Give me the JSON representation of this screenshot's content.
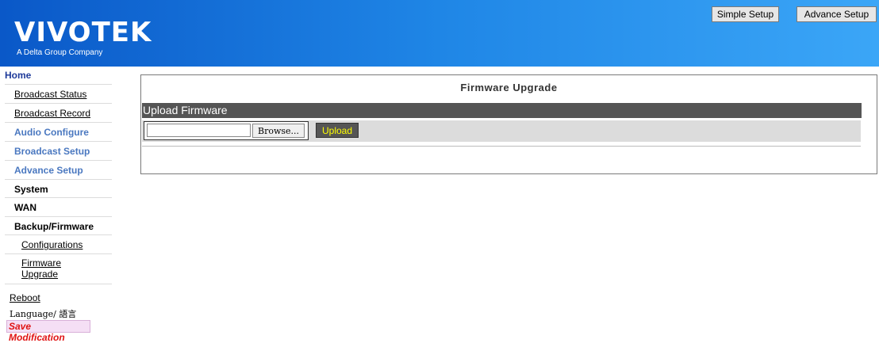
{
  "header": {
    "logo": "VIVOTEK",
    "logo_sub": "A Delta Group Company",
    "buttons": {
      "simple": "Simple Setup",
      "advance": "Advance Setup"
    }
  },
  "sidebar": {
    "home": "Home",
    "items": [
      {
        "label": "Broadcast Status"
      },
      {
        "label": "Broadcast Record"
      },
      {
        "label": "Audio Configure"
      },
      {
        "label": "Broadcast Setup"
      },
      {
        "label": "Advance Setup"
      },
      {
        "label": "System"
      },
      {
        "label": "WAN"
      },
      {
        "label": "Backup/Firmware"
      },
      {
        "label": "Configurations"
      },
      {
        "label": "Firmware Upgrade"
      }
    ],
    "reboot": "Reboot",
    "language": "Language/ 語言",
    "save": "Save Modification"
  },
  "main": {
    "title": "Firmware Upgrade",
    "section": "Upload Firmware",
    "file_input_value": "",
    "browse_label": "Browse...",
    "upload_label": "Upload"
  },
  "colors": {
    "header_start": "#0a58c8",
    "header_end": "#3ba6f7",
    "section_bar": "#555555",
    "upload_text": "#ffff00",
    "save_text": "#e01414"
  }
}
